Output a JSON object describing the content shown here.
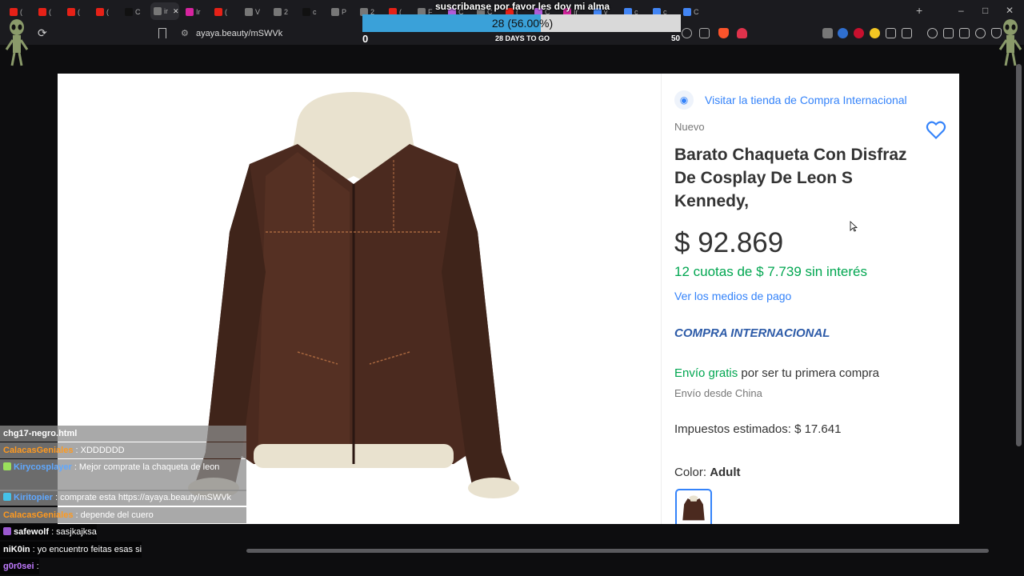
{
  "browser": {
    "tabs": [
      {
        "icon": "youtube-icon",
        "label": "(",
        "color": "#e62117"
      },
      {
        "icon": "youtube-icon",
        "label": "(",
        "color": "#e62117"
      },
      {
        "icon": "youtube-icon",
        "label": "(",
        "color": "#e62117"
      },
      {
        "icon": "youtube-icon",
        "label": "(",
        "color": "#e62117"
      },
      {
        "icon": "tiktok-icon",
        "label": "C",
        "color": "#111111"
      },
      {
        "icon": "page-icon",
        "label": "ir",
        "color": "#777777"
      },
      {
        "icon": "instagram-icon",
        "label": "Ir",
        "color": "#d6249f"
      },
      {
        "icon": "youtube-icon",
        "label": "(",
        "color": "#e62117"
      },
      {
        "icon": "page-icon",
        "label": "V",
        "color": "#777777"
      },
      {
        "icon": "page-icon",
        "label": "2",
        "color": "#777777"
      },
      {
        "icon": "tiktok-icon",
        "label": "c",
        "color": "#111111"
      },
      {
        "icon": "page-icon",
        "label": "P",
        "color": "#777777"
      },
      {
        "icon": "page-icon",
        "label": "2",
        "color": "#777777"
      },
      {
        "icon": "youtube-icon",
        "label": "(",
        "color": "#e62117"
      },
      {
        "icon": "page-icon",
        "label": "F",
        "color": "#777777"
      },
      {
        "icon": "pen-icon",
        "label": "C",
        "color": "#b05cd8"
      },
      {
        "icon": "page-icon",
        "label": "C",
        "color": "#777777"
      },
      {
        "icon": "youtube-icon",
        "label": "(",
        "color": "#e62117"
      },
      {
        "icon": "pen-icon",
        "label": "C",
        "color": "#b05cd8"
      },
      {
        "icon": "instagram-icon",
        "label": "Ir",
        "color": "#d6249f"
      },
      {
        "icon": "google-icon",
        "label": "v",
        "color": "#4285f4"
      },
      {
        "icon": "google-icon",
        "label": "c",
        "color": "#4285f4"
      },
      {
        "icon": "globe-icon",
        "label": "c",
        "color": "#4285f4"
      },
      {
        "icon": "globe-icon",
        "label": "C",
        "color": "#4285f4"
      }
    ],
    "new_tab": "+",
    "url": "ayaya.beauty/mSWVk"
  },
  "goal": {
    "title": "suscribanse por favor les doy mi alma",
    "value_text": "28 (56.00%)",
    "progress": 0.56,
    "days": "28 DAYS TO GO",
    "min": "0",
    "max": "50"
  },
  "product": {
    "visit_store": "Visitar la tienda de Compra Internacional",
    "condition": "Nuevo",
    "title": "Barato Chaqueta Con Disfraz De Cosplay De Leon S Kennedy,",
    "price": "$ 92.869",
    "installments": "12 cuotas de $ 7.739 sin interés",
    "payment_methods": "Ver los medios de pago",
    "international": "COMPRA INTERNACIONAL",
    "shipping_free": "Envío gratis",
    "shipping_rest": " por ser tu primera compra",
    "shipping_origin": "Envío desde China",
    "taxes": "Impuestos estimados: $ 17.641",
    "color_label": "Color: ",
    "color_value": "Adult",
    "accent": "#3483fa",
    "green": "#00a650"
  },
  "chat": [
    {
      "name": "",
      "text": "chg17-negro.html",
      "name_color": "#ffffff",
      "badge": "",
      "style": "gray"
    },
    {
      "name": "CalacasGeniales",
      "text": " : XDDDDDD",
      "name_color": "#ff9a1f",
      "badge": "",
      "style": "gray"
    },
    {
      "name": "Kirycosplayer",
      "text": " : Mejor comprate la chaqueta de leon",
      "name_color": "#5fa8ff",
      "badge": "#9ae05c",
      "style": "gray"
    },
    {
      "name": "",
      "text": "",
      "name_color": "#ffffff",
      "badge": "",
      "style": "gray"
    },
    {
      "name": "Kiritopier",
      "text": " : comprate esta https://ayaya.beauty/mSWVk",
      "name_color": "#5fa8ff",
      "badge": "#45c2e8",
      "style": "gray"
    },
    {
      "name": "CalacasGeniales",
      "text": " : depende del cuero",
      "name_color": "#ff9a1f",
      "badge": "",
      "style": "gray"
    },
    {
      "name": "safewolf",
      "text": " : sasjkajksa",
      "name_color": "#ffffff",
      "badge": "#9b59d0",
      "style": "dark"
    },
    {
      "name": "niK0in",
      "text": " : yo encuentro feitas esas si",
      "name_color": "#ffffff",
      "badge": "",
      "style": "dark"
    },
    {
      "name": "g0r0sei",
      "text": " : ",
      "name_color": "#c07bff",
      "badge": "",
      "style": "dark"
    }
  ]
}
